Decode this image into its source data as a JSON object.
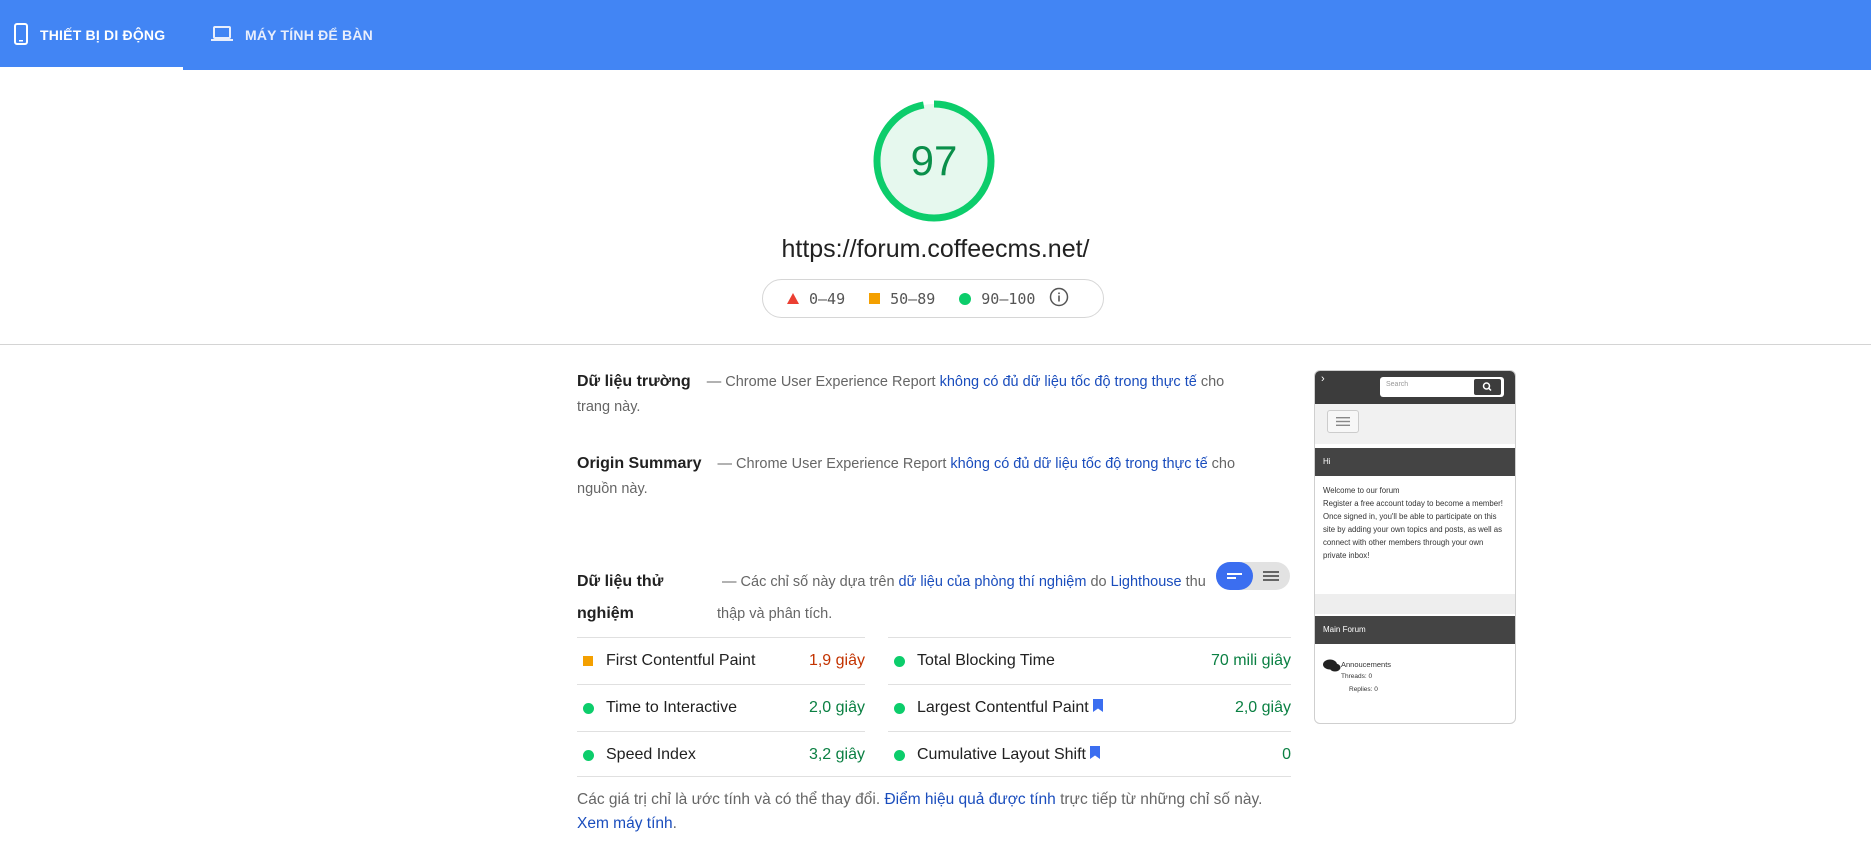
{
  "tabs": {
    "mobile": "THIẾT BỊ DI ĐỘNG",
    "desktop": "MÁY TÍNH ĐỂ BÀN"
  },
  "score": {
    "value": "97",
    "level": 0.97,
    "color": "#0ccd6b"
  },
  "url": "https://forum.coffeecms.net/",
  "legend": {
    "fail": "0–49",
    "average": "50–89",
    "pass": "90–100"
  },
  "field_data": {
    "title": "Dữ liệu trường",
    "prefix": "— Chrome User Experience Report",
    "link": "không có đủ dữ liệu tốc độ trong thực tế",
    "suffix": "cho trang này."
  },
  "origin_summary": {
    "title": "Origin Summary",
    "prefix": "— Chrome User Experience Report",
    "link": "không có đủ dữ liệu tốc độ trong thực tế",
    "suffix": "cho nguồn này."
  },
  "lab_data": {
    "title": "Dữ liệu thử nghiệm",
    "prefix": "— Các chỉ số này dựa trên",
    "link1": "dữ liệu của phòng thí nghiệm",
    "mid": "do",
    "link2": "Lighthouse",
    "suffix": "thu thập và phân tích."
  },
  "metrics": {
    "fcp": {
      "label": "First Contentful Paint",
      "value": "1,9 giây",
      "status": "average"
    },
    "tbt": {
      "label": "Total Blocking Time",
      "value": "70 mili giây",
      "status": "pass"
    },
    "tti": {
      "label": "Time to Interactive",
      "value": "2,0 giây",
      "status": "pass"
    },
    "lcp": {
      "label": "Largest Contentful Paint",
      "value": "2,0 giây",
      "status": "pass"
    },
    "si": {
      "label": "Speed Index",
      "value": "3,2 giây",
      "status": "pass"
    },
    "cls": {
      "label": "Cumulative Layout Shift",
      "value": "0",
      "status": "pass"
    }
  },
  "colors": {
    "header": "#4285f4",
    "pass": "#0ccd6b",
    "pass_text": "#0b8043",
    "average": "#f4a000",
    "average_text": "#c33300",
    "fail": "#eb3f32",
    "link": "#1a4dbd",
    "bookmark": "#3b6ef0"
  },
  "note": {
    "prefix": "Các giá trị chỉ là ước tính và có thể thay đổi.",
    "link1": "Điểm hiệu quả được tính",
    "mid": "trực tiếp từ những chỉ số này.",
    "link2": "Xem máy tính",
    "suffix": "."
  },
  "screenshot": {
    "search_placeholder": "Search",
    "hi": "Hi",
    "welcome": "Welcome to our forum",
    "body": "Register a free account today to become a member! Once signed in, you'll be able to participate on this site by adding your own topics and posts, as well as connect with other members through your own private inbox!",
    "main_forum": "Main Forum",
    "forum_item": "Annoucements",
    "threads": "Threads: 0",
    "replies": "Replies: 0"
  }
}
